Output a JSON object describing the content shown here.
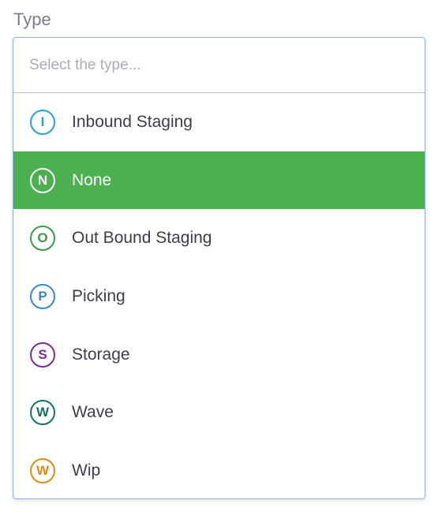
{
  "field": {
    "label": "Type"
  },
  "search": {
    "placeholder": "Select the type..."
  },
  "options": [
    {
      "letter": "I",
      "label": "Inbound Staging",
      "color": "#2a9fd8",
      "selected": false
    },
    {
      "letter": "N",
      "label": "None",
      "color": "#ffffff",
      "selected": true
    },
    {
      "letter": "O",
      "label": "Out Bound Staging",
      "color": "#3d9a4a",
      "selected": false
    },
    {
      "letter": "P",
      "label": "Picking",
      "color": "#3d87d1",
      "selected": false
    },
    {
      "letter": "S",
      "label": "Storage",
      "color": "#7d2c8e",
      "selected": false
    },
    {
      "letter": "W",
      "label": "Wave",
      "color": "#13716a",
      "selected": false
    },
    {
      "letter": "W",
      "label": "Wip",
      "color": "#e08a14",
      "selected": false
    }
  ],
  "colors": {
    "selected_background": "#4caf50",
    "border": "#8fb4e3"
  }
}
